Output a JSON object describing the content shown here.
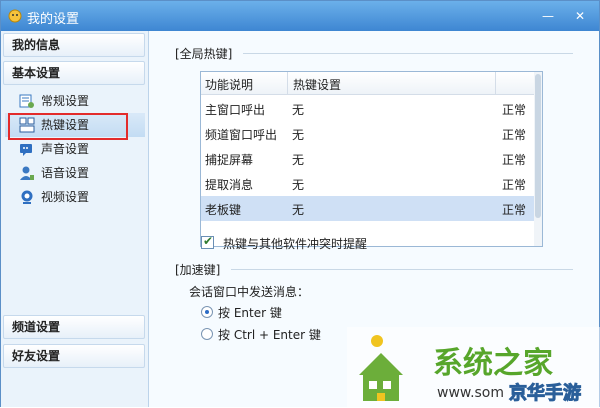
{
  "window": {
    "title": "我的设置"
  },
  "sidebar": {
    "categories": {
      "my_info": "我的信息",
      "basic": "基本设置",
      "channel": "频道设置",
      "friends": "好友设置"
    },
    "items": [
      {
        "label": "常规设置",
        "icon": "general-settings-icon"
      },
      {
        "label": "热键设置",
        "icon": "hotkey-icon",
        "selected": true
      },
      {
        "label": "声音设置",
        "icon": "sound-icon"
      },
      {
        "label": "语音设置",
        "icon": "voice-icon"
      },
      {
        "label": "视频设置",
        "icon": "webcam-icon"
      }
    ]
  },
  "global_hotkeys": {
    "section_label": "[全局热键]",
    "columns": [
      "功能说明",
      "热键设置"
    ],
    "rows": [
      {
        "function": "主窗口呼出",
        "key": "无",
        "status": "正常"
      },
      {
        "function": "频道窗口呼出",
        "key": "无",
        "status": "正常"
      },
      {
        "function": "捕捉屏幕",
        "key": "无",
        "status": "正常"
      },
      {
        "function": "提取消息",
        "key": "无",
        "status": "正常"
      },
      {
        "function": "老板键",
        "key": "无",
        "status": "正常"
      }
    ],
    "conflict_checkbox": {
      "label": "热键与其他软件冲突时提醒",
      "checked": true
    }
  },
  "accelerators": {
    "section_label": "[加速键]",
    "prompt": "会话窗口中发送消息：",
    "options": [
      {
        "label": "按 Enter 键",
        "selected": true
      },
      {
        "label": "按 Ctrl + Enter 键",
        "selected": false
      }
    ]
  },
  "watermark": {
    "title": "系统之家",
    "url": "www.som",
    "overlay": "京华手游"
  },
  "colors": {
    "title_bar": "#4a95dc",
    "selection_highlight": "#e32b2b",
    "row_selected": "#cfe0f5"
  }
}
